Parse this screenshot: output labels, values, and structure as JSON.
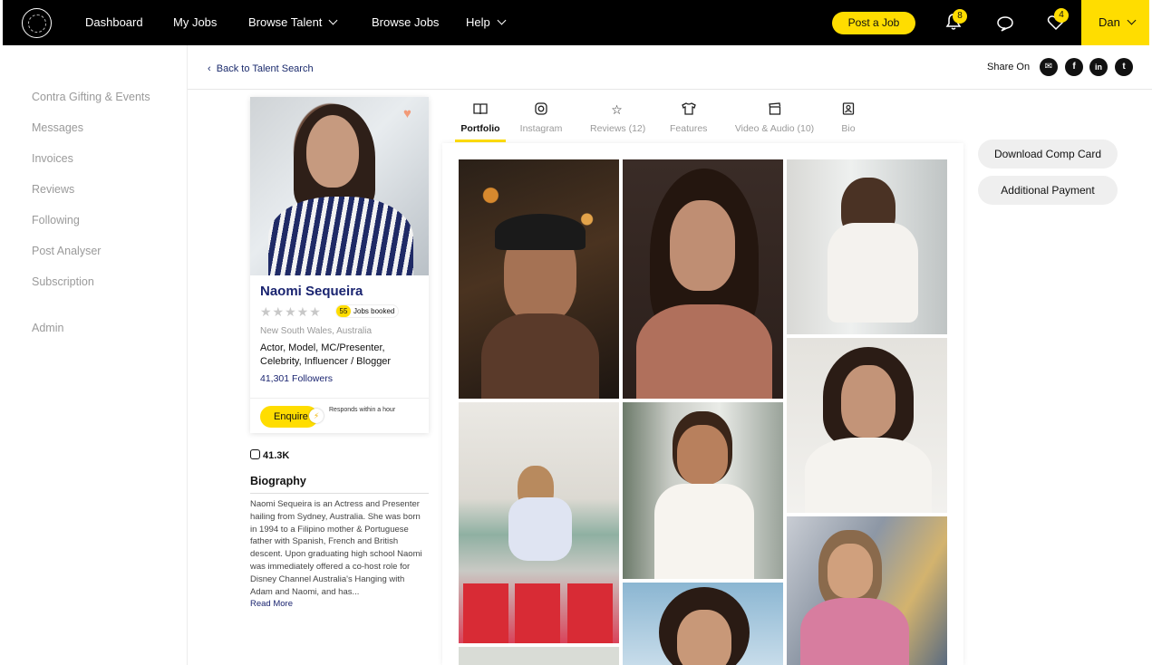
{
  "nav": {
    "links": [
      {
        "label": "Dashboard"
      },
      {
        "label": "My Jobs"
      },
      {
        "label": "Browse Talent"
      },
      {
        "label": "Browse Jobs"
      },
      {
        "label": "Help"
      }
    ],
    "post_job": "Post a Job",
    "notifications_count": "8",
    "favourites_count": "4",
    "user": "Dan"
  },
  "sidebar": {
    "items": [
      {
        "label": "Contra Gifting & Events"
      },
      {
        "label": "Messages"
      },
      {
        "label": "Invoices"
      },
      {
        "label": "Reviews"
      },
      {
        "label": "Following"
      },
      {
        "label": "Post Analyser"
      },
      {
        "label": "Subscription"
      },
      {
        "label": "Admin"
      }
    ]
  },
  "header": {
    "back_link": "Back to Talent Search",
    "share_label": "Share On"
  },
  "profile": {
    "name": "Naomi Sequeira",
    "rating": 0,
    "jobs_booked_count": "55",
    "jobs_booked_label": "Jobs booked",
    "location": "New South Wales, Australia",
    "roles": "Actor, Model, MC/Presenter, Celebrity, Influencer / Blogger",
    "followers": "41,301 Followers",
    "enquire": "Enquire",
    "responds": "Responds within a hour",
    "instagram_count": "41.3K",
    "bio_title": "Biography",
    "bio_text": "Naomi Sequeira is an Actress and Presenter hailing from Sydney, Australia. She was born in 1994 to a Filipino mother & Portuguese father with Spanish, French and British descent. Upon graduating high school Naomi was immediately offered a co-host role for Disney Channel Australia's Hanging with Adam and Naomi, and has...",
    "read_more": "Read More"
  },
  "tabs": [
    {
      "label": "Portfolio",
      "icon": "book-icon",
      "active": true
    },
    {
      "label": "Instagram",
      "icon": "instagram-icon"
    },
    {
      "label": "Reviews (12)",
      "icon": "star-icon"
    },
    {
      "label": "Features",
      "icon": "shirt-icon"
    },
    {
      "label": "Video & Audio (10)",
      "icon": "clapper-icon"
    },
    {
      "label": "Bio",
      "icon": "id-card-icon"
    }
  ],
  "actions": {
    "download": "Download Comp Card",
    "payment": "Additional Payment"
  },
  "colors": {
    "accent": "#ffdd00",
    "nav_bg": "#000000",
    "link": "#1a2470"
  }
}
